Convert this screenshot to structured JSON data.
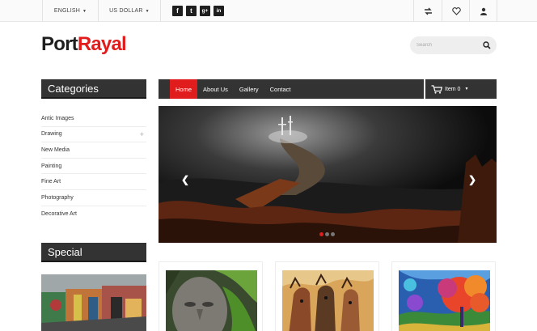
{
  "topbar": {
    "language": "ENGLISH",
    "currency": "US DOLLAR",
    "social": [
      "facebook-icon",
      "twitter-icon",
      "google-plus-icon",
      "linkedin-icon"
    ],
    "icons": [
      "compare-icon",
      "heart-icon",
      "user-icon"
    ]
  },
  "logo": {
    "part1": "Port",
    "part2": "Rayal",
    "accent": "#e01c1c"
  },
  "search": {
    "placeholder": "Search"
  },
  "sidebar": {
    "categories_title": "Categories",
    "categories": [
      "Antic Images",
      "Drawing",
      "New Media",
      "Painting",
      "Fine Art",
      "Photography",
      "Decorative Art"
    ],
    "special_title": "Special"
  },
  "nav": {
    "items": [
      "Home",
      "About Us",
      "Gallery",
      "Contact"
    ],
    "active": "Home"
  },
  "cart": {
    "label": "Item 0"
  },
  "banner": {
    "slides": 3,
    "active_slide": 1
  },
  "colors": {
    "dark": "#333333",
    "accent": "#e01c1c"
  }
}
